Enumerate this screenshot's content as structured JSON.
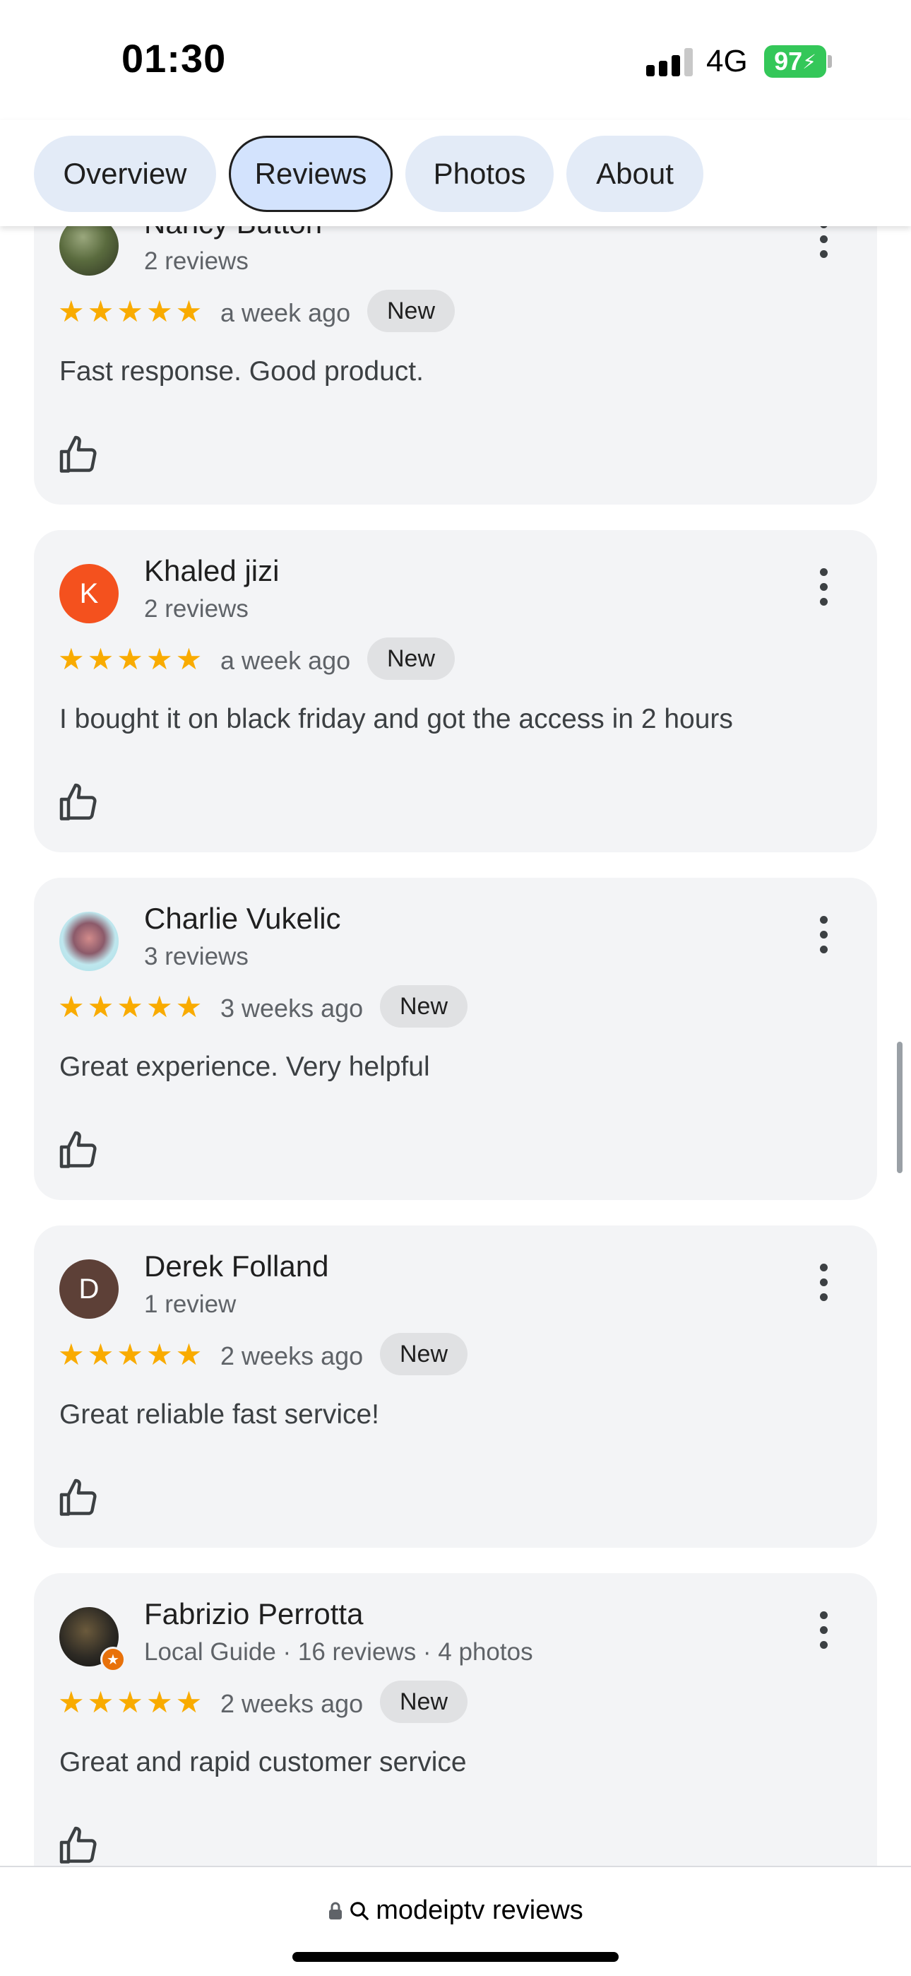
{
  "status_bar": {
    "time": "01:30",
    "network": "4G",
    "battery": "97"
  },
  "tabs": [
    {
      "label": "Overview",
      "active": false
    },
    {
      "label": "Reviews",
      "active": true
    },
    {
      "label": "Photos",
      "active": false
    },
    {
      "label": "About",
      "active": false
    }
  ],
  "reviews": [
    {
      "name": "Nancy Button",
      "meta": "2 reviews",
      "rating": 5,
      "stars": "★★★★★",
      "date": "a week ago",
      "badge": "New",
      "text": "Fast response. Good product.",
      "avatar_type": "photo"
    },
    {
      "name": "Khaled jizi",
      "meta": "2 reviews",
      "rating": 5,
      "stars": "★★★★★",
      "date": "a week ago",
      "badge": "New",
      "text": "I bought it on black friday and got the access in 2 hours",
      "avatar_initial": "K",
      "avatar_color": "#f4511e"
    },
    {
      "name": "Charlie Vukelic",
      "meta": "3 reviews",
      "rating": 5,
      "stars": "★★★★★",
      "date": "3 weeks ago",
      "badge": "New",
      "text": "Great experience. Very helpful",
      "avatar_type": "photo"
    },
    {
      "name": "Derek Folland",
      "meta": "1 review",
      "rating": 5,
      "stars": "★★★★★",
      "date": "2 weeks ago",
      "badge": "New",
      "text": "Great reliable fast service!",
      "avatar_initial": "D",
      "avatar_color": "#5d4037"
    },
    {
      "name": "Fabrizio Perrotta",
      "meta": "Local Guide · 16 reviews · 4 photos",
      "rating": 5,
      "stars": "★★★★★",
      "date": "2 weeks ago",
      "badge": "New",
      "text": "Great and rapid customer service",
      "avatar_type": "photo",
      "local_guide": true
    }
  ],
  "url_bar": {
    "text": "modeiptv reviews"
  },
  "colors": {
    "star": "#f9ab00",
    "card_bg": "#f3f4f6",
    "active_tab": "#d3e3fd",
    "battery": "#34c759"
  }
}
